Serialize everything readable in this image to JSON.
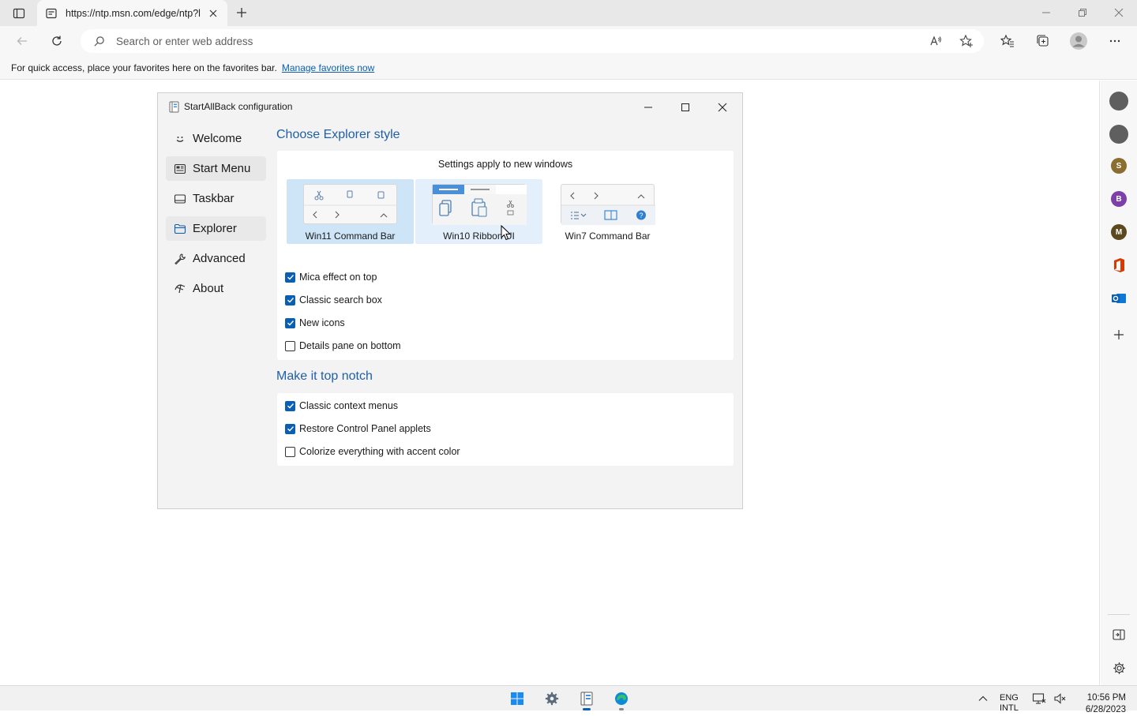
{
  "browser": {
    "tab": {
      "title": "https://ntp.msn.com/edge/ntp?l",
      "favicon": "page-icon"
    },
    "address": {
      "placeholder": "Search or enter web address"
    },
    "favorites_bar": {
      "message": "For quick access, place your favorites here on the favorites bar.",
      "link": "Manage favorites now"
    },
    "sidebar": {
      "items": [
        {
          "name": "sidebar-app-1",
          "letter": "",
          "color": "#5f5f5f"
        },
        {
          "name": "sidebar-app-2",
          "letter": "",
          "color": "#5f5f5f"
        },
        {
          "name": "sidebar-app-s",
          "letter": "S",
          "color": "#8a6d2f"
        },
        {
          "name": "sidebar-app-b",
          "letter": "B",
          "color": "#7d3fa8"
        },
        {
          "name": "sidebar-app-m",
          "letter": "M",
          "color": "#5b4a1e"
        }
      ]
    }
  },
  "dialog": {
    "title": "StartAllBack configuration",
    "nav": [
      {
        "label": "Welcome",
        "icon": "smile-icon"
      },
      {
        "label": "Start Menu",
        "icon": "start-menu-icon"
      },
      {
        "label": "Taskbar",
        "icon": "taskbar-icon"
      },
      {
        "label": "Explorer",
        "icon": "folder-icon"
      },
      {
        "label": "Advanced",
        "icon": "wrench-icon"
      },
      {
        "label": "About",
        "icon": "about-icon"
      }
    ],
    "explorer_style": {
      "title": "Choose Explorer style",
      "note": "Settings apply to new windows",
      "options": [
        {
          "label": "Win11 Command Bar",
          "state": "selected"
        },
        {
          "label": "Win10 Ribbon UI",
          "state": "hover"
        },
        {
          "label": "Win7 Command Bar",
          "state": "normal"
        }
      ],
      "checkboxes": [
        {
          "label": "Mica effect on top",
          "checked": true
        },
        {
          "label": "Classic search box",
          "checked": true
        },
        {
          "label": "New icons",
          "checked": true
        },
        {
          "label": "Details pane on bottom",
          "checked": false
        }
      ]
    },
    "top_notch": {
      "title": "Make it top notch",
      "checkboxes": [
        {
          "label": "Classic context menus",
          "checked": true
        },
        {
          "label": "Restore Control Panel applets",
          "checked": true
        },
        {
          "label": "Colorize everything with accent color",
          "checked": false
        }
      ]
    }
  },
  "taskbar": {
    "language": [
      "ENG",
      "INTL"
    ],
    "time": "10:56 PM",
    "date": "6/28/2023"
  },
  "colors": {
    "accent": "#0a5fb4",
    "section_title": "#1f5fa8",
    "selected_card": "#cde5f7"
  }
}
